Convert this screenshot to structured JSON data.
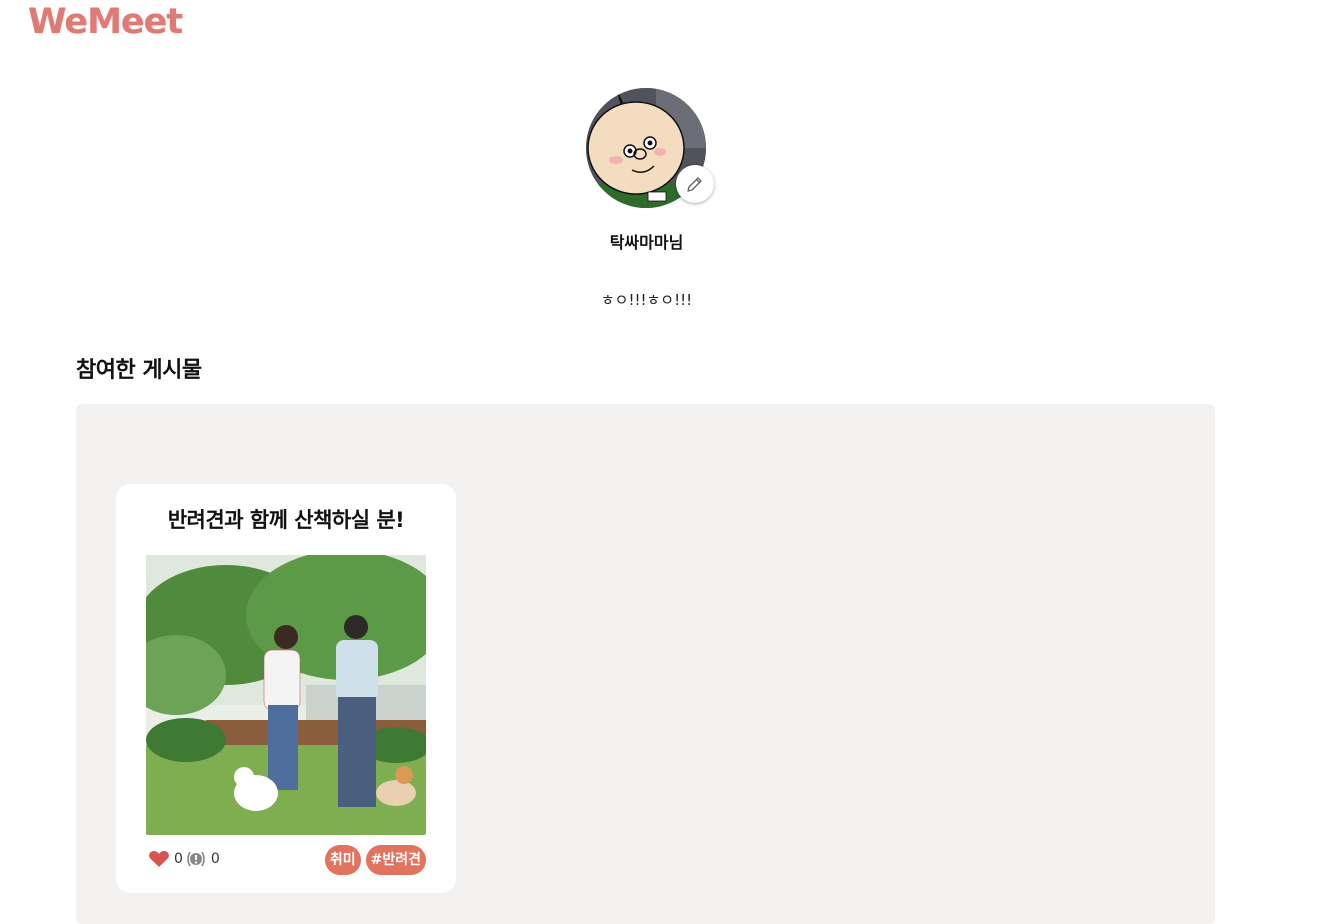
{
  "app": {
    "logo_text": "WeMeet",
    "brand_color": "#e07a74"
  },
  "profile": {
    "nickname": "탁싸마마님",
    "intro": "ㅎㅇ!!!ㅎㅇ!!!",
    "avatar_icon": "avatar-image",
    "edit_icon": "pencil-icon"
  },
  "section": {
    "title": "참여한 게시물"
  },
  "posts": [
    {
      "title": "반려견과 함께 산책하실 분!",
      "likes": "0",
      "reports": "0",
      "tags": [
        "취미",
        "#반려견"
      ],
      "tag_color": "#e2735f"
    }
  ]
}
